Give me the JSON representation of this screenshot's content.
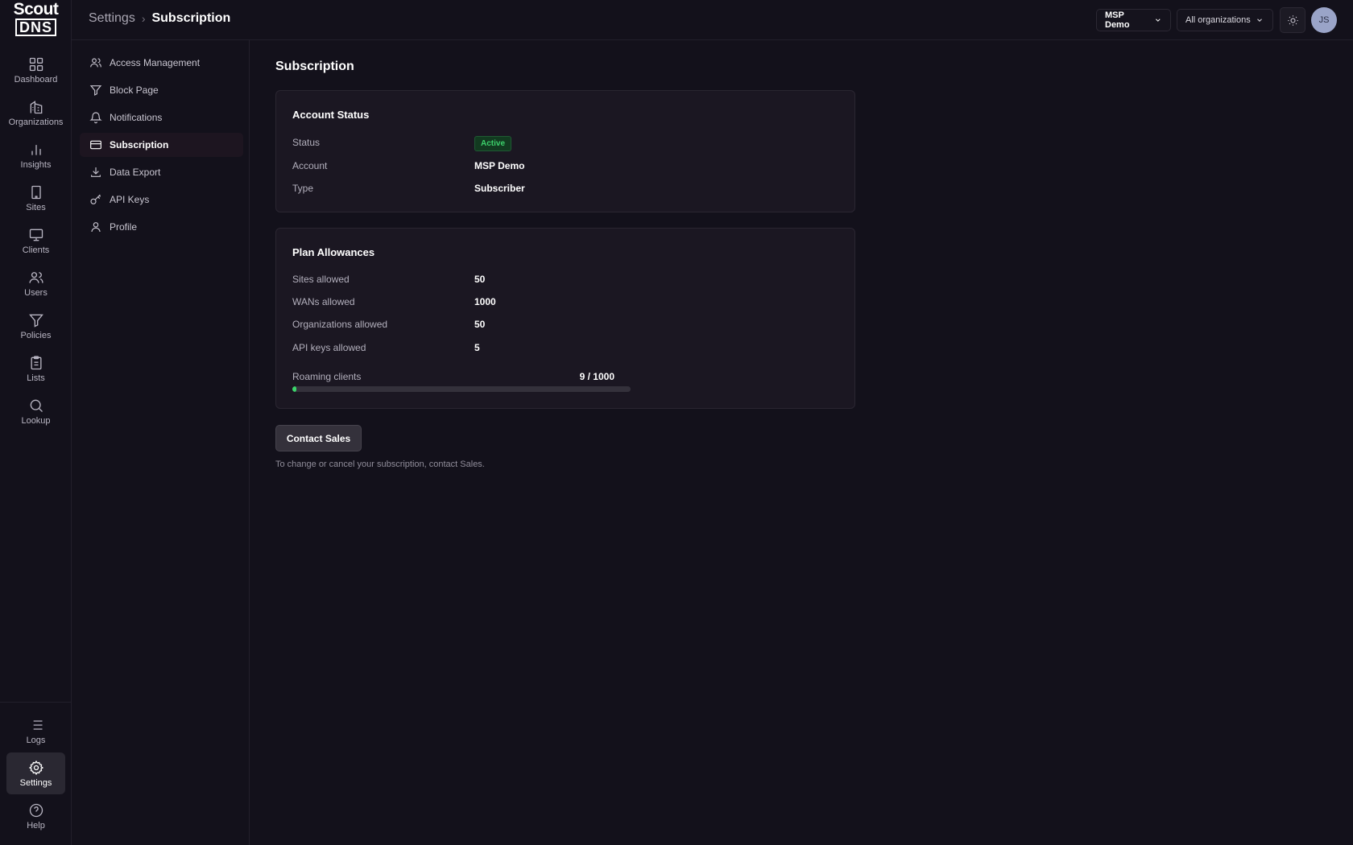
{
  "brand": {
    "logo_top": "Scout",
    "logo_bottom": "DNS"
  },
  "rail": {
    "items": [
      {
        "label": "Dashboard",
        "icon": "grid-icon"
      },
      {
        "label": "Organizations",
        "icon": "building-icon"
      },
      {
        "label": "Insights",
        "icon": "bar-chart-icon"
      },
      {
        "label": "Sites",
        "icon": "site-building-icon"
      },
      {
        "label": "Clients",
        "icon": "monitor-icon"
      },
      {
        "label": "Users",
        "icon": "users-icon"
      },
      {
        "label": "Policies",
        "icon": "filter-icon"
      },
      {
        "label": "Lists",
        "icon": "clipboard-icon"
      },
      {
        "label": "Lookup",
        "icon": "search-icon"
      }
    ],
    "bottom": [
      {
        "label": "Logs",
        "icon": "list-icon"
      },
      {
        "label": "Settings",
        "icon": "gear-icon",
        "active": true
      },
      {
        "label": "Help",
        "icon": "help-icon"
      }
    ]
  },
  "topbar": {
    "breadcrumb": [
      "Settings",
      "Subscription"
    ],
    "org_selector": "MSP Demo",
    "scope_selector": "All organizations",
    "theme_icon": "sun-icon",
    "avatar_initials": "JS"
  },
  "settings_nav": {
    "items": [
      {
        "label": "Access Management",
        "icon": "users-icon"
      },
      {
        "label": "Block Page",
        "icon": "filter-icon"
      },
      {
        "label": "Notifications",
        "icon": "bell-icon"
      },
      {
        "label": "Subscription",
        "icon": "credit-card-icon",
        "active": true
      },
      {
        "label": "Data Export",
        "icon": "download-icon"
      },
      {
        "label": "API Keys",
        "icon": "key-icon"
      },
      {
        "label": "Profile",
        "icon": "user-icon"
      }
    ]
  },
  "main": {
    "title": "Subscription",
    "account_status": {
      "title": "Account Status",
      "status_label": "Status",
      "status_value": "Active",
      "account_label": "Account",
      "account_value": "MSP Demo",
      "type_label": "Type",
      "type_value": "Subscriber"
    },
    "plan": {
      "title": "Plan Allowances",
      "rows": [
        {
          "label": "Sites allowed",
          "value": "50"
        },
        {
          "label": "WANs allowed",
          "value": "1000"
        },
        {
          "label": "Organizations allowed",
          "value": "50"
        },
        {
          "label": "API keys allowed",
          "value": "5"
        }
      ],
      "roaming_label": "Roaming clients",
      "roaming_count": "9 / 1000",
      "roaming_used": 9,
      "roaming_total": 1000
    },
    "contact_button": "Contact Sales",
    "hint": "To change or cancel your subscription, contact Sales."
  },
  "colors": {
    "accent_green": "#3bd46a",
    "background": "#13111b",
    "card": "#1b1722"
  }
}
